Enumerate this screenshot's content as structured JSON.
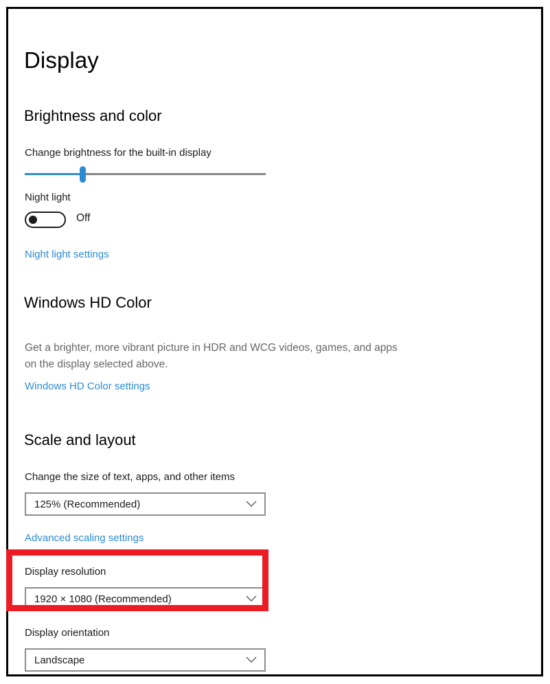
{
  "window": {
    "border_color": "#000000"
  },
  "page": {
    "title": "Display"
  },
  "sections": {
    "brightness_and_color": {
      "heading": "Brightness and color",
      "brightness": {
        "label": "Change brightness for the built-in display",
        "value_percent": 24,
        "fill_color": "#2d8bd2",
        "track_color": "#868686"
      },
      "night_light": {
        "label": "Night light",
        "toggle_state": "Off",
        "toggle_on": false,
        "settings_link": "Night light settings"
      }
    },
    "windows_hd_color": {
      "heading": "Windows HD Color",
      "description": "Get a brighter, more vibrant picture in HDR and WCG videos, games, and apps on the display selected above.",
      "settings_link": "Windows HD Color settings"
    },
    "scale_and_layout": {
      "heading": "Scale and layout",
      "scale": {
        "label": "Change the size of text, apps, and other items",
        "selected": "125% (Recommended)",
        "chevron_icon": "chevron-down-icon"
      },
      "advanced_scaling_link": "Advanced scaling settings",
      "resolution": {
        "label": "Display resolution",
        "selected": "1920 × 1080 (Recommended)",
        "chevron_icon": "chevron-down-icon",
        "highlighted": true,
        "highlight_color": "#ed1c24"
      },
      "orientation": {
        "label": "Display orientation",
        "selected": "Landscape",
        "chevron_icon": "chevron-down-icon"
      }
    }
  },
  "colors": {
    "link": "#2d8bd2",
    "accent": "#2d8bd2",
    "muted_text": "#666666",
    "combo_border": "#8d8d8d",
    "annotation": "#ed1c24"
  }
}
